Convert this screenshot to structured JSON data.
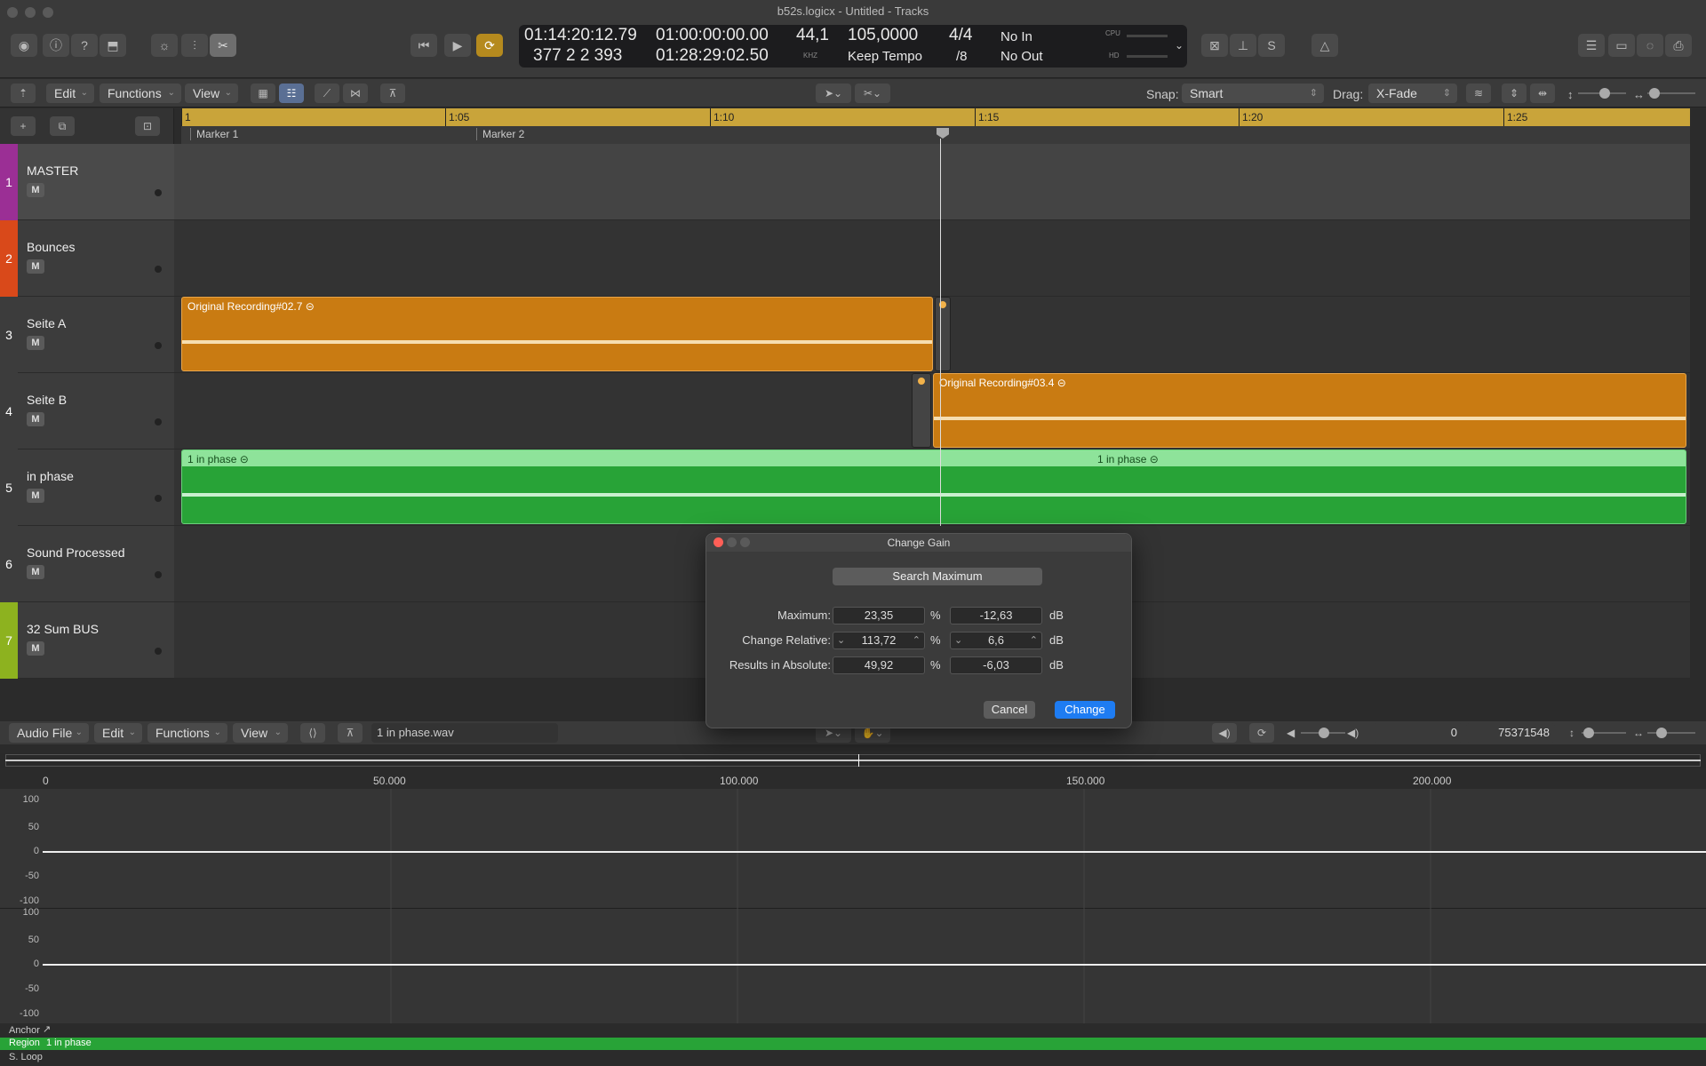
{
  "window": {
    "title": "b52s.logicx - Untitled - Tracks"
  },
  "lcd": {
    "position_time": "01:14:20:12.79",
    "position_bars": "377  2  2  393",
    "start_time": "01:00:00:00.00",
    "end_time": "01:28:29:02.50",
    "sample_rate": "44,1",
    "sample_rate_unit": "KHZ",
    "tempo": "105,0000",
    "tempo_mode": "Keep Tempo",
    "signature": "4/4",
    "division": "/8",
    "in": "No In",
    "out": "No Out",
    "cpu_label": "CPU",
    "hd_label": "HD"
  },
  "editbar": {
    "edit": "Edit",
    "functions": "Functions",
    "view": "View",
    "snap_label": "Snap:",
    "snap_value": "Smart",
    "drag_label": "Drag:",
    "drag_value": "X-Fade"
  },
  "ruler": {
    "ticks": [
      "1",
      "1:05",
      "1:10",
      "1:15",
      "1:20",
      "1:25"
    ],
    "markers": [
      "Marker 1",
      "Marker 2"
    ]
  },
  "tracks": [
    {
      "num": "1",
      "name": "MASTER",
      "mute": "M",
      "color": "#9b2f95"
    },
    {
      "num": "2",
      "name": "Bounces",
      "mute": "M",
      "color": "#d9491a"
    },
    {
      "num": "3",
      "name": "Seite A",
      "mute": "M",
      "color": "#3c3c3c"
    },
    {
      "num": "4",
      "name": "Seite B",
      "mute": "M",
      "color": "#3c3c3c"
    },
    {
      "num": "5",
      "name": "in phase",
      "mute": "M",
      "color": "#3c3c3c"
    },
    {
      "num": "6",
      "name": "Sound Processed",
      "mute": "M",
      "color": "#3c3c3c"
    },
    {
      "num": "7",
      "name": "32 Sum BUS",
      "mute": "M",
      "color": "#8db21f"
    }
  ],
  "regions": {
    "seite_a": "Original Recording#02.7",
    "seite_b": "Original Recording#03.4",
    "in_phase_1": "1 in phase",
    "in_phase_2": "1 in phase"
  },
  "colors": {
    "audio_region": "#c97b12",
    "green_region": "#28a337",
    "green_header": "#8ee39a",
    "accent_blue": "#1e7cf2"
  },
  "dialog": {
    "title": "Change Gain",
    "search_button": "Search Maximum",
    "maximum_label": "Maximum:",
    "maximum_pct": "23,35",
    "maximum_db": "-12,63",
    "relative_label": "Change Relative:",
    "relative_pct": "113,72",
    "relative_db": "6,6",
    "absolute_label": "Results in Absolute:",
    "absolute_pct": "49,92",
    "absolute_db": "-6,03",
    "pct_unit": "%",
    "db_unit": "dB",
    "cancel": "Cancel",
    "change": "Change"
  },
  "editor": {
    "audio_file": "Audio File",
    "edit": "Edit",
    "functions": "Functions",
    "view": "View",
    "filename": "1 in phase.wav",
    "sample_start": "0",
    "sample_end": "75371548",
    "sample_ticks": [
      "0",
      "50.000",
      "100.000",
      "150.000",
      "200.000"
    ],
    "y_labels": [
      "100",
      "50",
      "0",
      "-50",
      "-100"
    ],
    "anchor": "Anchor",
    "region_label": "Region",
    "region_name": "1 in phase",
    "loop": "S. Loop"
  }
}
